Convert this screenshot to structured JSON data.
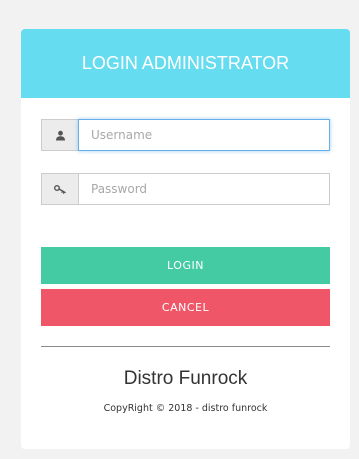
{
  "header": {
    "title": "LOGIN ADMINISTRATOR"
  },
  "form": {
    "username": {
      "placeholder": "Username",
      "value": "",
      "icon": "user-icon"
    },
    "password": {
      "placeholder": "Password",
      "value": "",
      "icon": "key-icon"
    }
  },
  "buttons": {
    "login_label": "LOGIN",
    "cancel_label": "CANCEL"
  },
  "footer": {
    "brand": "Distro Funrock",
    "copyright": "CopyRight © 2018 - distro funrock"
  },
  "colors": {
    "header_bg": "#66dcf0",
    "login_button": "#44cba3",
    "cancel_button": "#ef5769",
    "page_bg": "#f2f2f2"
  }
}
